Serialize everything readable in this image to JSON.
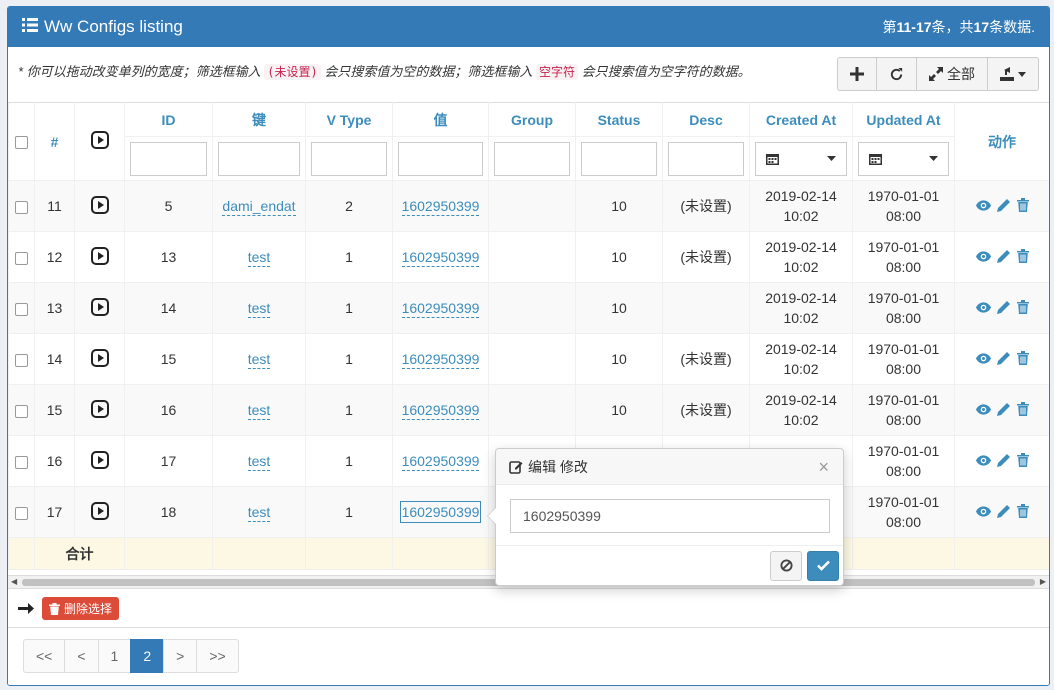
{
  "header": {
    "title": "Ww Configs listing",
    "summary_prefix": "第",
    "summary_range": "11-17",
    "summary_mid": "条，共",
    "summary_total": "17",
    "summary_suffix": "条数据."
  },
  "hint": {
    "part1": "* 你可以拖动改变单列的宽度；筛选框输入",
    "tag1": "(未设置)",
    "part2": "会只搜索值为空的数据；筛选框输入",
    "tag2": "空字符",
    "part3": "会只搜索值为空字符的数据。"
  },
  "toolbar": {
    "all_label": "全部"
  },
  "columns": [
    "#",
    "ID",
    "键",
    "V Type",
    "值",
    "Group",
    "Status",
    "Desc",
    "Created At",
    "Updated At",
    "动作"
  ],
  "rows": [
    {
      "num": "11",
      "id": "5",
      "key": "dami_endat",
      "vtype": "2",
      "value": "1602950399",
      "group": "",
      "status": "10",
      "desc": "(未设置)",
      "created_date": "2019-02-14",
      "created_time": "10:02",
      "updated_date": "1970-01-01",
      "updated_time": "08:00"
    },
    {
      "num": "12",
      "id": "13",
      "key": "test",
      "vtype": "1",
      "value": "1602950399",
      "group": "",
      "status": "10",
      "desc": "(未设置)",
      "created_date": "2019-02-14",
      "created_time": "10:02",
      "updated_date": "1970-01-01",
      "updated_time": "08:00"
    },
    {
      "num": "13",
      "id": "14",
      "key": "test",
      "vtype": "1",
      "value": "1602950399",
      "group": "",
      "status": "10",
      "desc": "",
      "created_date": "2019-02-14",
      "created_time": "10:02",
      "updated_date": "1970-01-01",
      "updated_time": "08:00"
    },
    {
      "num": "14",
      "id": "15",
      "key": "test",
      "vtype": "1",
      "value": "1602950399",
      "group": "",
      "status": "10",
      "desc": "(未设置)",
      "created_date": "2019-02-14",
      "created_time": "10:02",
      "updated_date": "1970-01-01",
      "updated_time": "08:00"
    },
    {
      "num": "15",
      "id": "16",
      "key": "test",
      "vtype": "1",
      "value": "1602950399",
      "group": "",
      "status": "10",
      "desc": "(未设置)",
      "created_date": "2019-02-14",
      "created_time": "10:02",
      "updated_date": "1970-01-01",
      "updated_time": "08:00"
    },
    {
      "num": "16",
      "id": "17",
      "key": "test",
      "vtype": "1",
      "value": "1602950399",
      "group": "",
      "status": "",
      "desc": "",
      "created_date": "",
      "created_time": "",
      "updated_date": "1970-01-01",
      "updated_time": "08:00"
    },
    {
      "num": "17",
      "id": "18",
      "key": "test",
      "vtype": "1",
      "value": "1602950399",
      "group": "",
      "status": "",
      "desc": "",
      "created_date": "",
      "created_time": "",
      "updated_date": "1970-01-01",
      "updated_time": "08:00"
    }
  ],
  "total_label": "合计",
  "footer": {
    "delete_label": "删除选择"
  },
  "pagination": {
    "items": [
      "<<",
      "<",
      "1",
      "2",
      ">",
      ">>"
    ],
    "active": "2"
  },
  "popover": {
    "title": "编辑 修改",
    "value": "1602950399"
  },
  "colors": {
    "primary": "#337ab7",
    "link": "#3c8dbc",
    "danger": "#dd4b39",
    "total_bg": "#fcf8e3"
  }
}
